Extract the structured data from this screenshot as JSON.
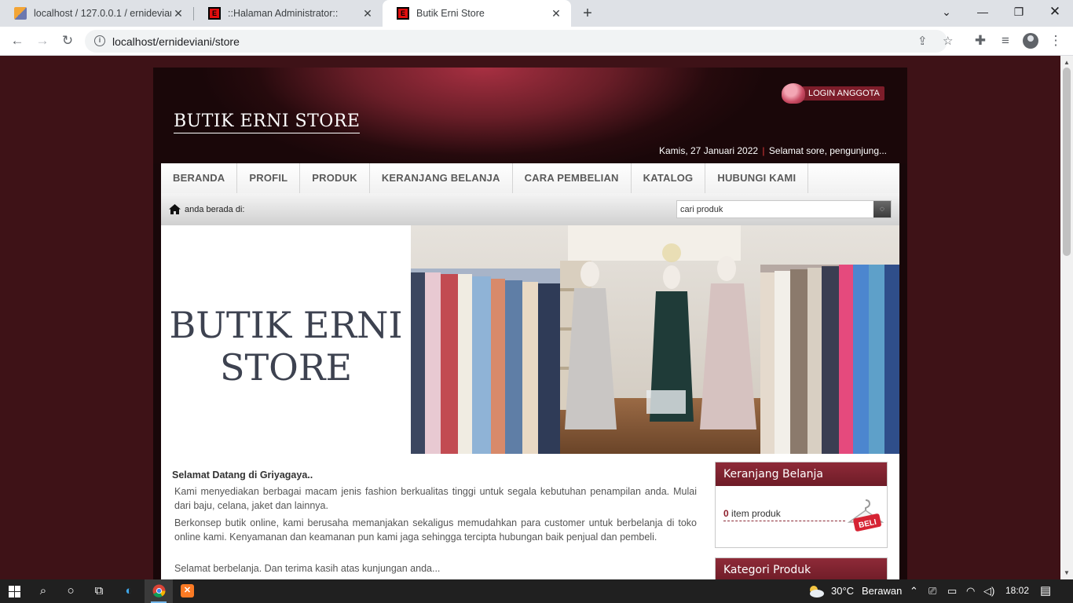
{
  "browser": {
    "tabs": [
      {
        "title": "localhost / 127.0.0.1 / ernidevian",
        "favicon": "phpmyadmin-icon"
      },
      {
        "title": "::Halaman Administrator::",
        "favicon": "store-e-icon"
      },
      {
        "title": "Butik Erni Store",
        "favicon": "store-e-icon",
        "active": true
      }
    ],
    "url": "localhost/ernideviani/store"
  },
  "site": {
    "logo": "BUTIK ERNI STORE",
    "login_label": "LOGIN ANGGOTA",
    "date": "Kamis, 27 Januari 2022",
    "date_sep": "|",
    "greeting": "Selamat sore, pengunjung...",
    "nav": [
      "BERANDA",
      "PROFIL",
      "PRODUK",
      "KERANJANG BELANJA",
      "CARA PEMBELIAN",
      "KATALOG",
      "HUBUNGI KAMI"
    ],
    "breadcrumb": "anda berada di:",
    "search_value": "cari produk",
    "banner_title_line1": "BUTIK ERNI",
    "banner_title_line2": "STORE"
  },
  "content": {
    "welcome_title": "Selamat Datang di  Griyagaya..",
    "paragraphs": [
      "Kami menyediakan berbagai macam jenis fashion berkualitas tinggi untuk segala kebutuhan penampilan anda. Mulai dari baju, celana, jaket dan lainnya.",
      "Berkonsep butik online, kami berusaha memanjakan sekaligus memudahkan para customer untuk berbelanja di toko online kami. Kenyamanan dan keamanan pun kami jaga sehingga tercipta hubungan baik penjual dan pembeli.",
      "Selamat berbelanja. Dan terima kasih atas kunjungan anda..."
    ]
  },
  "sidebar": {
    "cart_title": "Keranjang Belanja",
    "cart_count": "0",
    "cart_text": " item produk",
    "cart_badge": "BELI",
    "category_title": "Kategori Produk"
  },
  "taskbar": {
    "temperature": "30°C",
    "weather": "Berawan",
    "time": "18:02"
  },
  "colors": {
    "page_bg": "#3e1217",
    "accent": "#7d1d2a"
  }
}
